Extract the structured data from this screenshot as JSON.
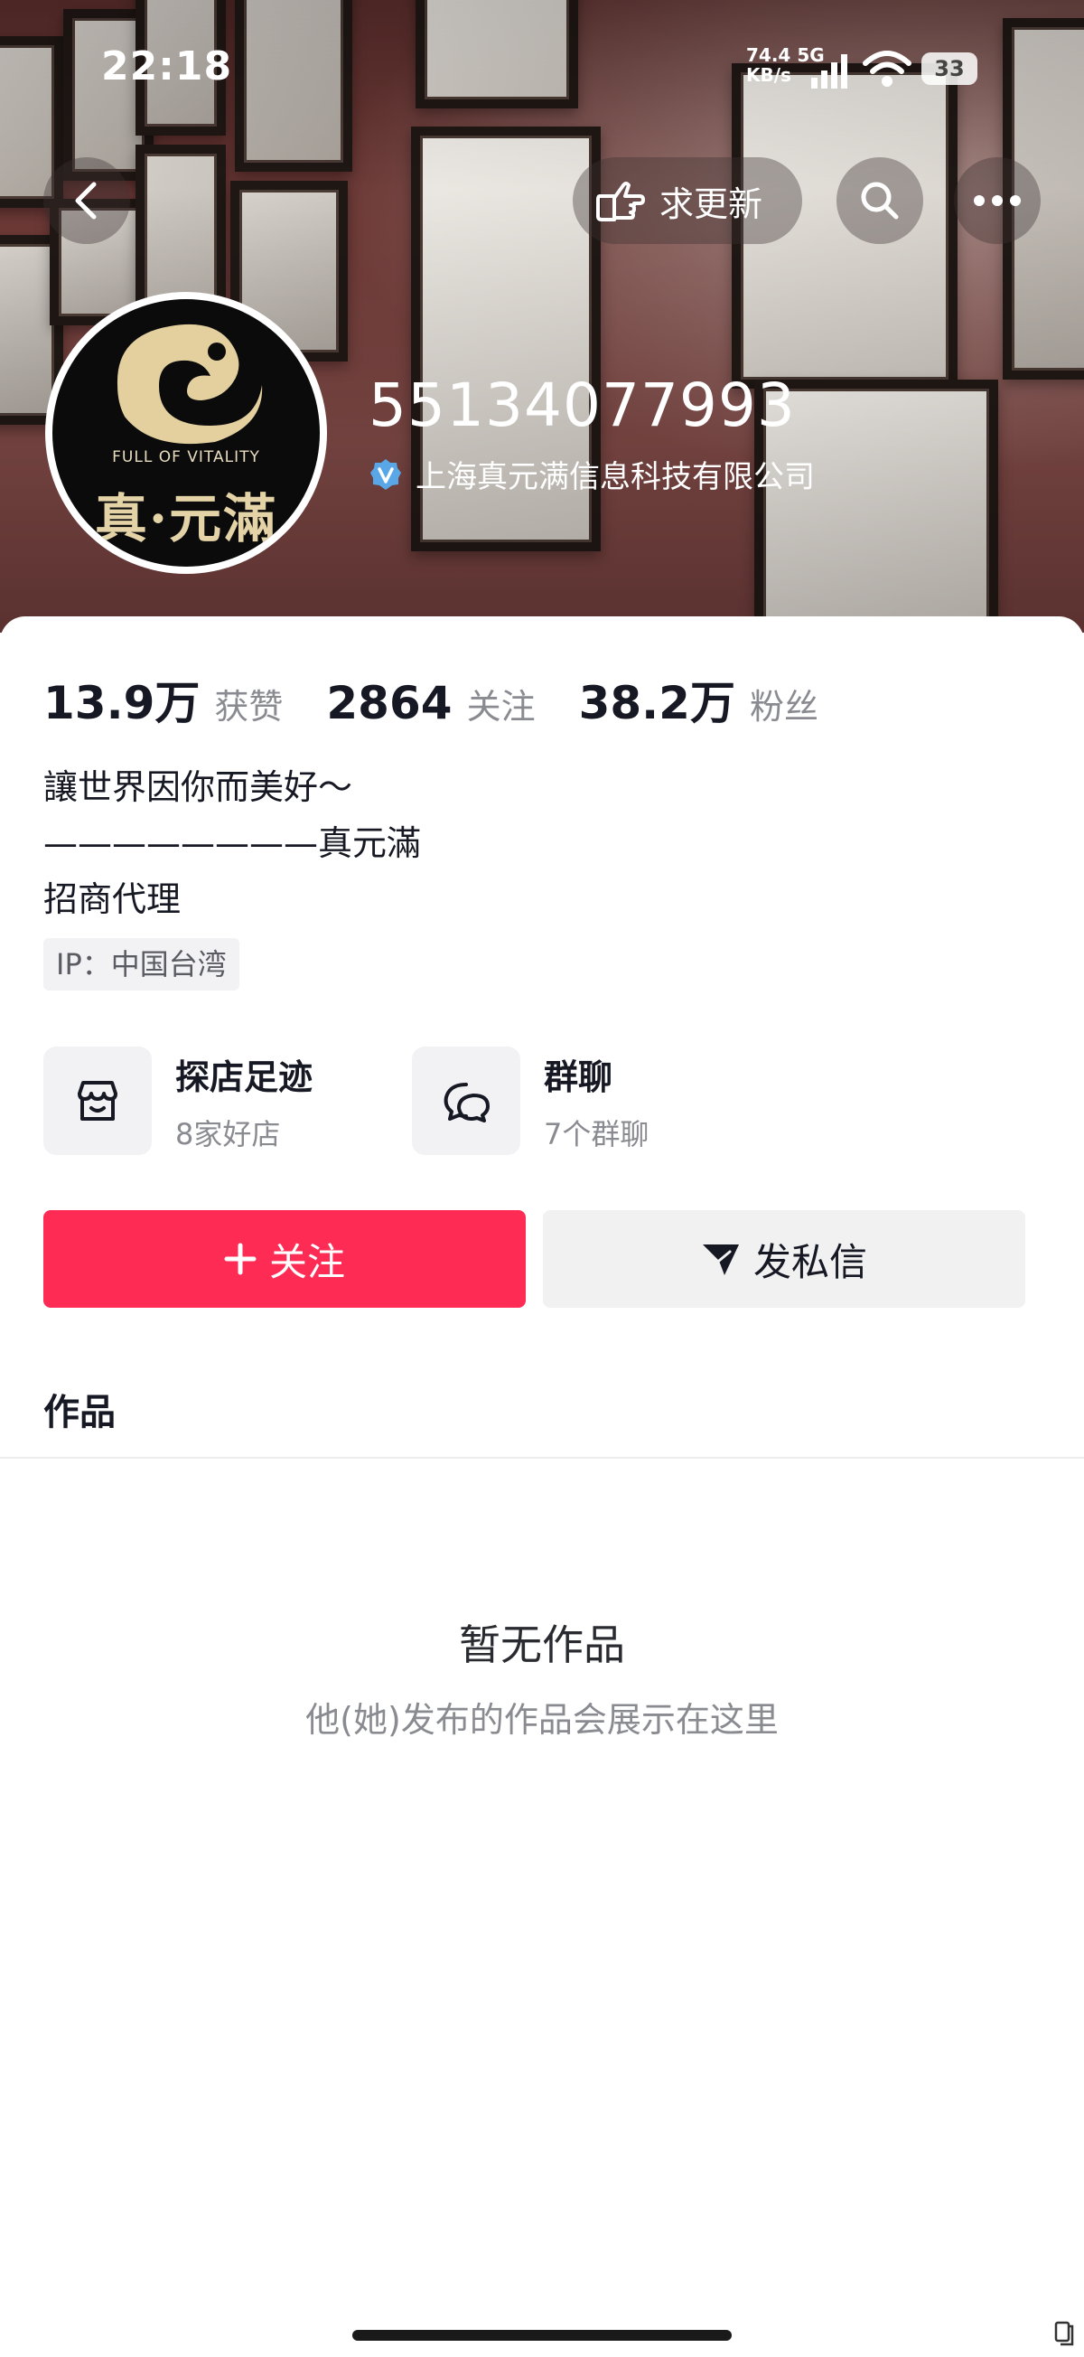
{
  "status_bar": {
    "time": "22:18",
    "net_speed": "74.4",
    "net_unit": "KB/s",
    "net_type": "5G",
    "battery": "33"
  },
  "top_bar": {
    "update_request_label": "求更新",
    "icons": [
      "back-icon",
      "point-hand-icon",
      "search-icon",
      "more-icon"
    ]
  },
  "profile": {
    "nickname": "55134077993",
    "verified_label": "上海真元满信息科技有限公司",
    "avatar_tagline": "FULL OF VITALITY",
    "avatar_text": "真·元滿"
  },
  "stats": [
    {
      "value": "13.9万",
      "label": "获赞"
    },
    {
      "value": "2864",
      "label": "关注"
    },
    {
      "value": "38.2万",
      "label": "粉丝"
    }
  ],
  "bio": {
    "line1": "讓世界因你而美好～",
    "line2": "————————真元滿",
    "line3": "招商代理"
  },
  "ip_label": "IP：中国台湾",
  "entries": [
    {
      "title": "探店足迹",
      "subtitle": "8家好店",
      "icon": "store-icon"
    },
    {
      "title": "群聊",
      "subtitle": "7个群聊",
      "icon": "group-chat-icon"
    }
  ],
  "actions": {
    "follow_label": "关注",
    "message_label": "发私信"
  },
  "works_tab_label": "作品",
  "empty_state": {
    "title": "暂无作品",
    "subtitle": "他(她)发布的作品会展示在这里"
  },
  "colors": {
    "accent": "#fe2c55",
    "banner": "#6e3a37",
    "text_primary": "#161823",
    "text_secondary": "#8a8b91"
  }
}
